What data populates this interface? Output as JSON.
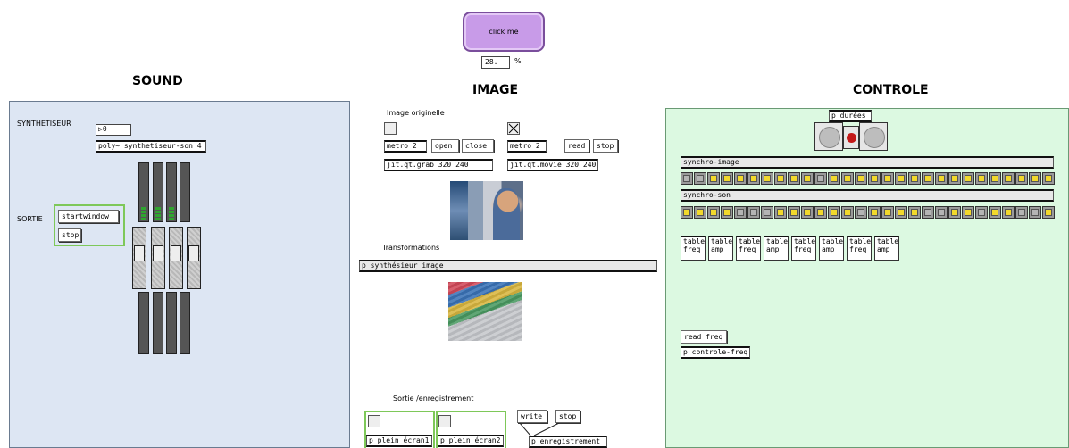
{
  "top": {
    "click_button": "click me",
    "percent_value": "28.",
    "percent_unit": "%"
  },
  "sections": {
    "sound": "SOUND",
    "image": "IMAGE",
    "controle": "CONTROLE"
  },
  "sound": {
    "synth_label": "SYNTHETISEUR",
    "number_value": "0",
    "poly_object": "poly~ synthetiseur-son 4",
    "sortie_label": "SORTIE",
    "start_button": "startwindow",
    "stop_button": "stop"
  },
  "image": {
    "original_label": "Image originelle",
    "metro_left": "metro 2",
    "open_button": "open",
    "close_button": "close",
    "grab_object": "jit.qt.grab 320 240",
    "metro_right": "metro 2",
    "read_button": "read",
    "stop_button": "stop",
    "movie_object": "jit.qt.movie 320 240",
    "transform_label": "Transformations",
    "synth_image_object": "p synthésieur image",
    "output_label": "Sortie /enregistrement",
    "plein1": "p plein écran1",
    "plein2": "p plein écran2",
    "write_button": "write",
    "stop2_button": "stop",
    "record_object": "p enregistrement"
  },
  "controle": {
    "durees_object": "p durées",
    "synchro_image": "synchro-image",
    "synchro_son": "synchro-son",
    "tables": [
      {
        "line1": "table",
        "line2": "freq"
      },
      {
        "line1": "table",
        "line2": "amp"
      },
      {
        "line1": "table",
        "line2": "freq"
      },
      {
        "line1": "table",
        "line2": "amp"
      },
      {
        "line1": "table",
        "line2": "freq"
      },
      {
        "line1": "table",
        "line2": "amp"
      },
      {
        "line1": "table",
        "line2": "freq"
      },
      {
        "line1": "table",
        "line2": "amp"
      }
    ],
    "read_freq": "read freq",
    "controle_freq": "p controle-freq",
    "image_row_states": [
      0,
      0,
      1,
      1,
      1,
      1,
      1,
      1,
      1,
      1,
      0,
      1,
      1,
      1,
      1,
      1,
      1,
      1,
      1,
      1,
      1,
      1,
      1,
      1,
      1,
      1,
      1,
      1
    ],
    "son_row_states": [
      1,
      1,
      1,
      1,
      0,
      0,
      0,
      1,
      1,
      1,
      1,
      1,
      1,
      0,
      1,
      1,
      1,
      1,
      0,
      0,
      1,
      1,
      0,
      1,
      1,
      0,
      0,
      1
    ]
  },
  "colors": {
    "sound_panel": "#dde6f3",
    "controle_panel": "#dcf9e1",
    "click_button": "#c89be8",
    "group_border": "#7ec859",
    "led_on": "#f2d92c",
    "led_off": "#b4b4b4"
  }
}
